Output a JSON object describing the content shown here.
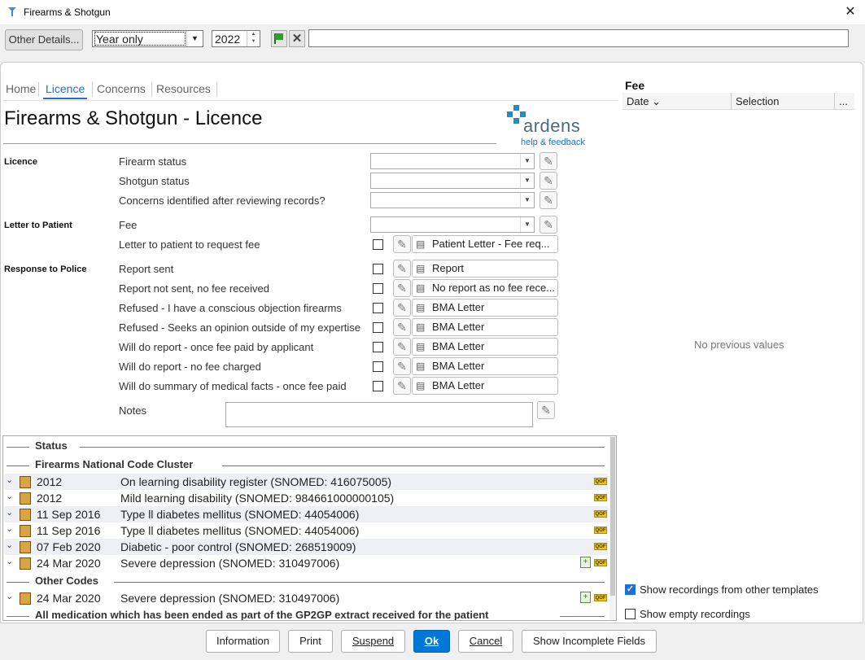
{
  "window": {
    "title": "Firearms & Shotgun",
    "close": "✕"
  },
  "toolbar": {
    "other_details": "Other Details...",
    "period_selected": "Year only",
    "year": "2022",
    "filter_value": ""
  },
  "tabs": [
    "Home",
    "Licence",
    "Concerns",
    "Resources"
  ],
  "active_tab": "Licence",
  "page_title": "Firearms & Shotgun - Licence",
  "logo": {
    "text": "ardens",
    "help": "help & feedback"
  },
  "sections": {
    "licence": "Licence",
    "letter": "Letter to Patient",
    "police": "Response to Police"
  },
  "fields": {
    "firearm_status": "Firearm status",
    "shotgun_status": "Shotgun status",
    "concerns": "Concerns identified after reviewing records?",
    "fee": "Fee",
    "letter_fee": "Letter to patient to request fee",
    "report_sent": "Report sent",
    "report_not_sent": "Report not sent, no fee received",
    "refused_objection": "Refused - I have a conscious objection firearms",
    "refused_expertise": "Refused - Seeks an opinion outside of my expertise",
    "will_do_fee": "Will do report - once fee paid by applicant",
    "will_do_no_fee": "Will do report - no fee charged",
    "will_do_summary": "Will do summary of medical facts - once fee paid",
    "notes": "Notes"
  },
  "letters": {
    "letter_fee": "Patient Letter - Fee req...",
    "report_sent": "Report",
    "report_not_sent": "No report as no fee rece...",
    "refused_objection": "BMA Letter",
    "refused_expertise": "BMA Letter",
    "will_do_fee": "BMA Letter",
    "will_do_no_fee": "BMA Letter",
    "will_do_summary": "BMA Letter"
  },
  "history": {
    "groups": [
      "Status",
      "Firearms National Code Cluster",
      "Other Codes",
      "All medication which has been ended as part of the GP2GP extract received for the patient"
    ],
    "rows": [
      {
        "date": "2012",
        "desc": "On learning disability register (SNOMED: 416075005)",
        "qof": "QOF"
      },
      {
        "date": "2012",
        "desc": "Mild learning disability (SNOMED: 984661000000105)",
        "qof": "QOF"
      },
      {
        "date": "11 Sep 2016",
        "desc": "Type ll diabetes mellitus (SNOMED: 44054006)",
        "qof": "QOF"
      },
      {
        "date": "11 Sep 2016",
        "desc": "Type ll diabetes mellitus (SNOMED: 44054006)",
        "qof": "QOF"
      },
      {
        "date": "07 Feb 2020",
        "desc": "Diabetic - poor control (SNOMED: 268519009)",
        "qof": "QOF"
      },
      {
        "date": "24 Mar 2020",
        "desc": "Severe depression (SNOMED: 310497006)",
        "qof": "QOF"
      },
      {
        "date": "24 Mar 2020",
        "desc": "Severe depression (SNOMED: 310497006)",
        "qof": "QOF"
      }
    ]
  },
  "fee_panel": {
    "title": "Fee",
    "col_date": "Date ⌄",
    "col_selection": "Selection",
    "col_more": "...",
    "empty": "No previous values",
    "show_other": "Show recordings from other templates",
    "show_empty": "Show empty recordings"
  },
  "buttons": {
    "information": "Information",
    "print": "Print",
    "suspend": "Suspend",
    "ok": "Ok",
    "cancel": "Cancel",
    "show_incomplete": "Show Incomplete Fields"
  }
}
